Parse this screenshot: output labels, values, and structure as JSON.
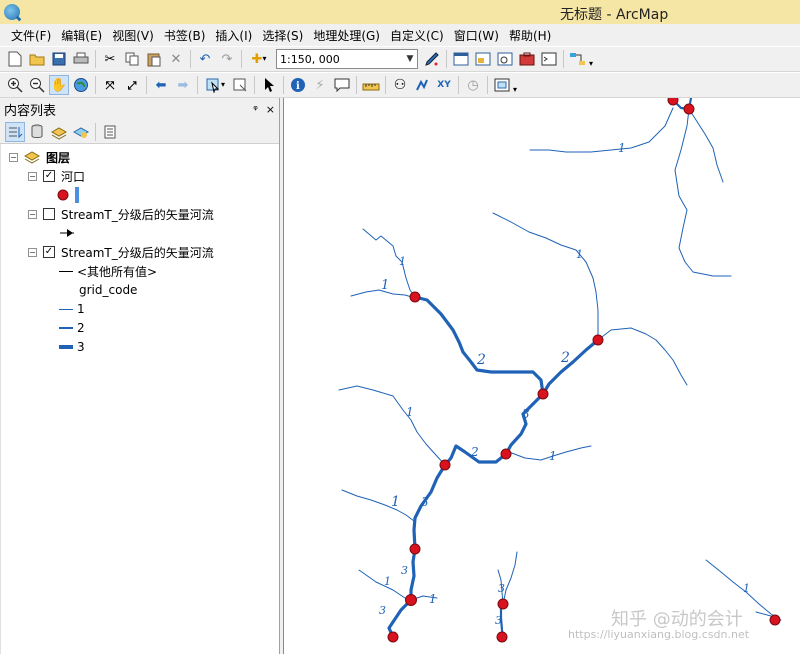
{
  "window": {
    "title": "无标题 - ArcMap"
  },
  "menu": [
    "文件(F)",
    "编辑(E)",
    "视图(V)",
    "书签(B)",
    "插入(I)",
    "选择(S)",
    "地理处理(G)",
    "自定义(C)",
    "窗口(W)",
    "帮助(H)"
  ],
  "toolbar": {
    "scale_value": "1:150, 000"
  },
  "toc": {
    "title": "内容列表",
    "pin_glyph": "ᵠ",
    "close_glyph": "×",
    "root": "图层",
    "layers": [
      {
        "name": "河口",
        "checked": true
      },
      {
        "name": "StreamT_分级后的矢量河流",
        "checked": false
      },
      {
        "name": "StreamT_分级后的矢量河流",
        "checked": true
      }
    ],
    "legend": {
      "other_values": "<其他所有值>",
      "field": "grid_code",
      "classes": [
        "1",
        "2",
        "3"
      ]
    }
  },
  "map": {
    "stream_labels": [
      "1",
      "1",
      "1",
      "2",
      "2",
      "1",
      "1",
      "3",
      "2",
      "1",
      "1",
      "3",
      "3",
      "1",
      "1",
      "3",
      "3",
      "3",
      "1"
    ],
    "colors": {
      "stream": "#1f62b6",
      "outlet": "#d8121e",
      "outlet_stroke": "#7a0a10"
    }
  },
  "watermark": {
    "text1": "知乎 @动的会计",
    "text2": "https://liyuanxiang.blog.csdn.net"
  }
}
